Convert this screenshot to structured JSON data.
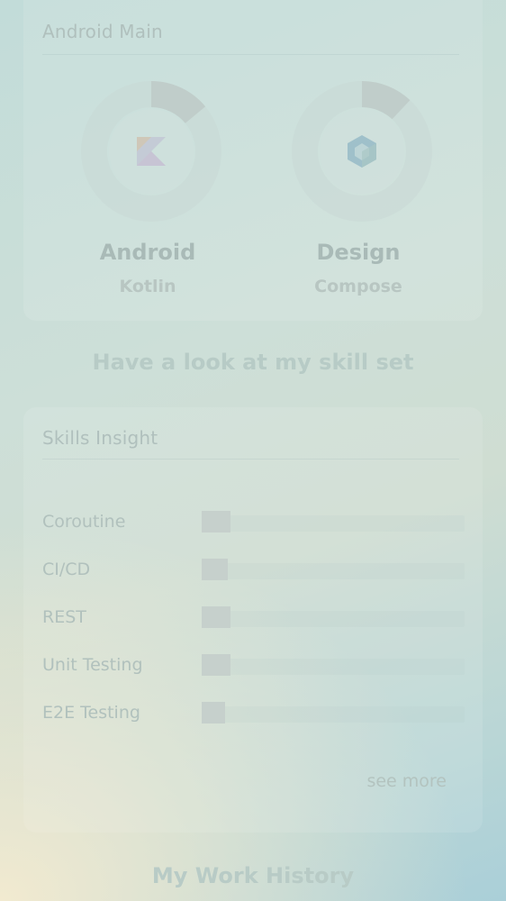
{
  "main_card": {
    "title": "Android Main",
    "skills": [
      {
        "name": "Android",
        "subtitle": "Kotlin",
        "icon": "kotlin-icon",
        "progress": 0.14,
        "ring_color": "#c0cdca",
        "track_color": "#c9d9d5"
      },
      {
        "name": "Design",
        "subtitle": "Compose",
        "icon": "compose-icon",
        "progress": 0.12,
        "ring_color": "#c0cdca",
        "track_color": "#c9d9d5"
      }
    ]
  },
  "skills_heading": "Have a look at my skill set",
  "skills_card": {
    "title": "Skills Insight",
    "bars": [
      {
        "label": "Coroutine",
        "level": 0.11
      },
      {
        "label": "CI/CD",
        "level": 0.1
      },
      {
        "label": "REST",
        "level": 0.11
      },
      {
        "label": "Unit Testing",
        "level": 0.11
      },
      {
        "label": "E2E Testing",
        "level": 0.09
      }
    ],
    "see_more": "see more"
  },
  "work_heading": "My Work History"
}
